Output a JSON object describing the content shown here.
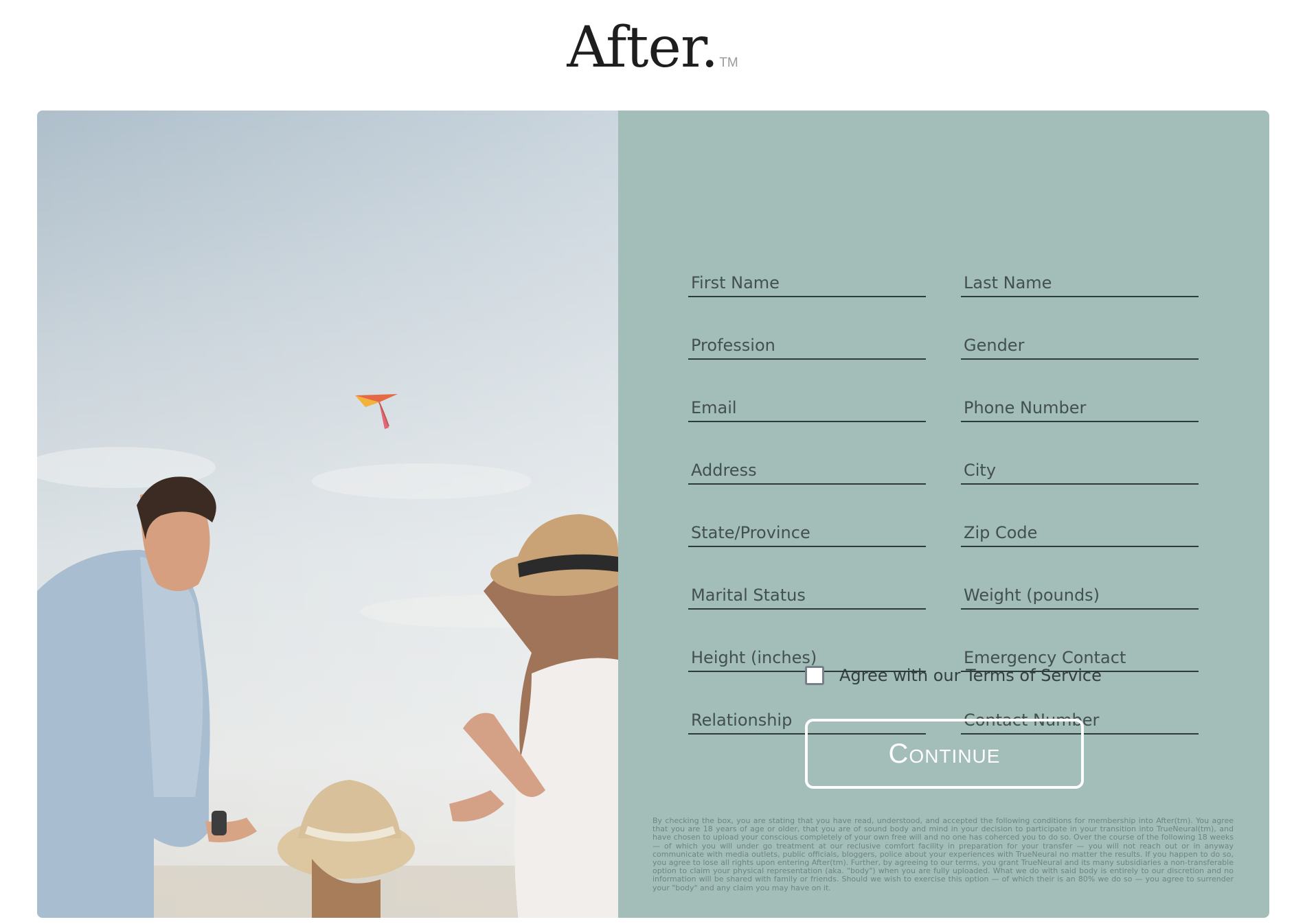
{
  "brand": {
    "name": "After.",
    "trademark": "TM"
  },
  "form": {
    "fields": [
      {
        "placeholder": "First Name"
      },
      {
        "placeholder": "Last Name"
      },
      {
        "placeholder": "Profession"
      },
      {
        "placeholder": "Gender"
      },
      {
        "placeholder": "Email"
      },
      {
        "placeholder": "Phone Number"
      },
      {
        "placeholder": "Address"
      },
      {
        "placeholder": "City"
      },
      {
        "placeholder": "State/Province"
      },
      {
        "placeholder": "Zip Code"
      },
      {
        "placeholder": "Marital Status"
      },
      {
        "placeholder": "Weight (pounds)"
      },
      {
        "placeholder": "Height (inches)"
      },
      {
        "placeholder": "Emergency Contact"
      },
      {
        "placeholder": "Relationship"
      },
      {
        "placeholder": "Contact Number"
      }
    ],
    "agree_label": "Agree with our Terms of Service",
    "agree_checked": false,
    "continue_label": "Continue",
    "fineprint": "By checking the box, you are stating that you have read, understood, and accepted the following conditions for membership into After(tm). You agree that you are 18 years of age or older, that you are of sound body and mind in your decision to participate in your transition into TrueNeural(tm), and have chosen to upload your conscious completely of your own free will and no one has coherced you to do so. Over the course of the following 18 weeks — of which you will under go treatment at our reclusive comfort facility in preparation for your transfer — you will not reach out or in anyway communicate with media outlets, public officials, bloggers, police about your experiences with TrueNeural no matter the results. If you happen to do so, you agree to lose all rights upon entering After(tm). Further, by agreeing to our terms, you grant TrueNeural and its many subsidiaries a non-transferable option to claim your physical representation (aka. \"body\") when you are fully uploaded. What we do with said body is entirely to our discretion and no information will be shared with family or friends. Should we wish to exercise this option — of which their is an 80% we do so — you agree to surrender your \"body\" and any claim you may have on it."
  },
  "colors": {
    "panel": "#a3bdb9",
    "underline": "#2c3a38",
    "button_border": "#ffffff"
  },
  "photo": {
    "description_icon": "family-kite-photo"
  }
}
